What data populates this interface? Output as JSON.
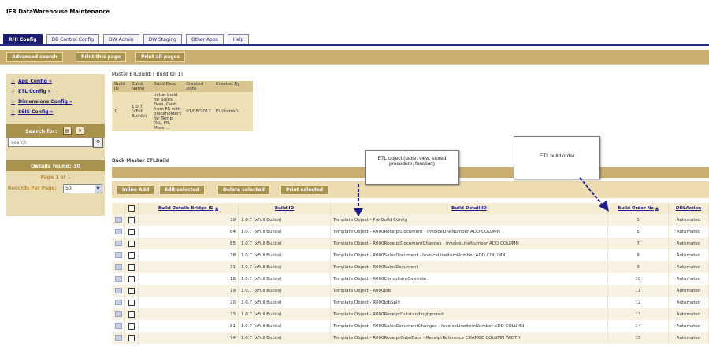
{
  "app": {
    "title": "IFR DataWarehouse Maintenance"
  },
  "tabs": [
    "RHI Config",
    "DB Control Config",
    "DW Admin",
    "DW Staging",
    "Other Apps",
    "Help"
  ],
  "toolbar": {
    "advanced_search": "Advanced search",
    "print_this_page": "Print this page",
    "print_all_pages": "Print all pages"
  },
  "sidebar": {
    "items": [
      "App Config »",
      "ETL Config »",
      "Dimensions Config »",
      "SSIS Config »"
    ],
    "search_label": "Search for:",
    "search_placeholder": "search",
    "details_found": "Details found: 30",
    "page_of": "Page 1 of 1",
    "records_per_page_label": "Records Per Page:",
    "records_per_page_value": "50"
  },
  "master": {
    "title": "Master ETLBuild: [ Build ID: 1]",
    "headers": [
      "Build ID",
      "Build Name",
      "Build Desc",
      "Created Date",
      "Created By"
    ],
    "row": {
      "build_id": "1",
      "build_name": "1.0.7 (xFull Buildx)",
      "build_desc": "Initial build for Sales, Fees, Cash from FS with placeholders for Temp (NL, FR, More ...",
      "created_date": "01/08/2012",
      "created_by": "EU\\fretre01"
    }
  },
  "back_link": "Back Master ETLBuild",
  "actions": {
    "inline_add": "Inline Add",
    "edit_selected": "Edit selected",
    "delete_selected": "Delete selected",
    "print_selected": "Print selected"
  },
  "grid": {
    "headers": {
      "bridge_id": "Build Details Bridge ID",
      "build_id": "Build ID",
      "detail_id": "Build Detail ID",
      "order_no": "Build Order No",
      "ddl_action": "DDLAction"
    },
    "rows": [
      {
        "bridge_id": "39",
        "build": "1.0.7 (xFull Buildx)",
        "detail": "Template Object - Pre Build Config",
        "order": "5",
        "action": "Automated"
      },
      {
        "bridge_id": "84",
        "build": "1.0.7 (xFull Buildx)",
        "detail": "Template Object - R000ReceiptDocument - InvoiceLineNumber ADD COLUMN",
        "order": "6",
        "action": "Automated"
      },
      {
        "bridge_id": "85",
        "build": "1.0.7 (xFull Buildx)",
        "detail": "Template Object - R000ReceiptDocumentChanges - InvoiceLineNumber ADD COLUMN",
        "order": "7",
        "action": "Automated"
      },
      {
        "bridge_id": "38",
        "build": "1.0.7 (xFull Buildx)",
        "detail": "Template Object - R000SalesDocument - InvoiceLineItemNumber ADD COLUMN",
        "order": "8",
        "action": "Automated"
      },
      {
        "bridge_id": "31",
        "build": "1.0.7 (xFull Buildx)",
        "detail": "Template Object - R000SalesDocument",
        "order": "9",
        "action": "Automated"
      },
      {
        "bridge_id": "18",
        "build": "1.0.7 (xFull Buildx)",
        "detail": "Template Object - R000ConsultantOverride",
        "order": "10",
        "action": "Automated"
      },
      {
        "bridge_id": "19",
        "build": "1.0.7 (xFull Buildx)",
        "detail": "Template Object - R000Job",
        "order": "11",
        "action": "Automated"
      },
      {
        "bridge_id": "20",
        "build": "1.0.7 (xFull Buildx)",
        "detail": "Template Object - R000JobSplit",
        "order": "12",
        "action": "Automated"
      },
      {
        "bridge_id": "23",
        "build": "1.0.7 (xFull Buildx)",
        "detail": "Template Object - R000ReceiptOutstandingIgnored",
        "order": "13",
        "action": "Automated"
      },
      {
        "bridge_id": "61",
        "build": "1.0.7 (xFull Buildx)",
        "detail": "Template Object - R000SalesDocumentChanges - InvoiceLineItemNumber ADD COLUMN",
        "order": "14",
        "action": "Automated"
      },
      {
        "bridge_id": "74",
        "build": "1.0.7 (xFull Buildx)",
        "detail": "Template Object - R000ReceiptCubeData - ReceiptReference CHANGE COLUMN WIDTH",
        "order": "15",
        "action": "Automated"
      }
    ]
  },
  "annotations": {
    "etl_object": "ETL object (table, view, stored procedure, function)",
    "etl_build_order": "ETL  build order"
  },
  "colors": {
    "accent": "#c9ae70",
    "tab_active": "#1c1c70",
    "arrow": "#1c1c8a"
  }
}
